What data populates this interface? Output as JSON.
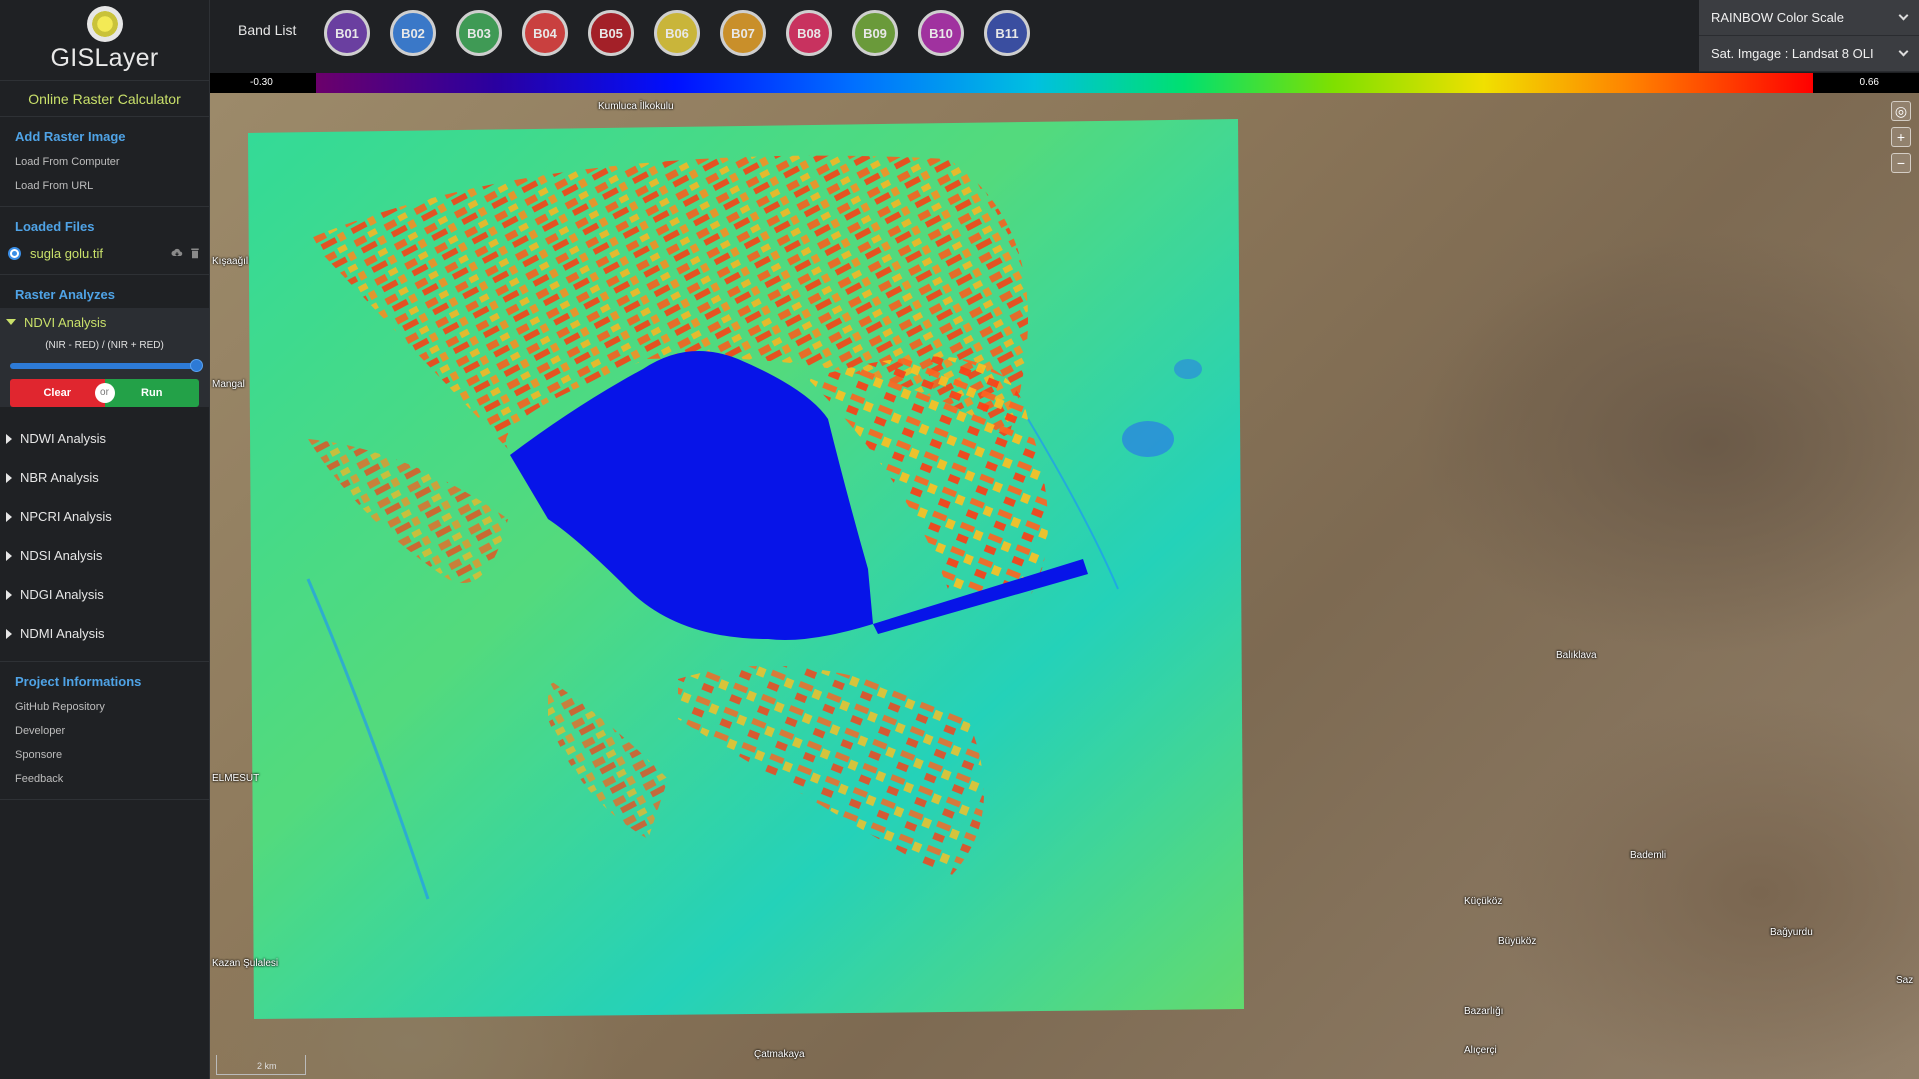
{
  "app": {
    "name": "GISLayer",
    "subtitle": "Online Raster Calculator"
  },
  "sidebar": {
    "add_raster": {
      "title": "Add Raster Image",
      "items": [
        "Load From Computer",
        "Load From URL"
      ]
    },
    "loaded_files": {
      "title": "Loaded Files",
      "files": [
        {
          "name": "sugla golu.tif",
          "selected": true
        }
      ]
    },
    "raster_analyzes": {
      "title": "Raster Analyzes",
      "active": {
        "label": "NDVI Analysis",
        "formula": "(NIR - RED) / (NIR + RED)",
        "slider_value": 1.0,
        "clear_label": "Clear",
        "or_label": "or",
        "run_label": "Run"
      },
      "items": [
        "NDWI Analysis",
        "NBR Analysis",
        "NPCRI Analysis",
        "NDSI Analysis",
        "NDGI Analysis",
        "NDMI Analysis"
      ]
    },
    "project": {
      "title": "Project Informations",
      "items": [
        "GitHub Repository",
        "Developer",
        "Sponsore",
        "Feedback"
      ]
    }
  },
  "topbar": {
    "band_list_label": "Band List",
    "bands": [
      {
        "label": "B01",
        "color": "#6a3fa0"
      },
      {
        "label": "B02",
        "color": "#3a78c8"
      },
      {
        "label": "B03",
        "color": "#3f9a55"
      },
      {
        "label": "B04",
        "color": "#c9403f"
      },
      {
        "label": "B05",
        "color": "#a32028"
      },
      {
        "label": "B06",
        "color": "#c9b53a"
      },
      {
        "label": "B07",
        "color": "#c98f2a"
      },
      {
        "label": "B08",
        "color": "#c8325f"
      },
      {
        "label": "B09",
        "color": "#6a9a3a"
      },
      {
        "label": "B10",
        "color": "#a0329f"
      },
      {
        "label": "B11",
        "color": "#3a4ea0"
      }
    ],
    "color_scale": "RAINBOW Color Scale",
    "sat_image": "Sat. Imgage : Landsat 8 OLI"
  },
  "scale": {
    "min": "-0.30",
    "max": "0.66"
  },
  "map": {
    "labels": [
      "Kumluca İlkokulu",
      "Balıklava",
      "Bademli",
      "Küçüköz",
      "Büyüköz",
      "Bağyurdu",
      "Alıçerçi",
      "Çatmakaya",
      "Mangal",
      "Kışaağıl",
      "ELMESUT",
      "Kazan Şulalesi",
      "Saz",
      "Bazarlığı"
    ],
    "zoom_in": "+",
    "zoom_out": "−",
    "scalebar": "2 km"
  }
}
